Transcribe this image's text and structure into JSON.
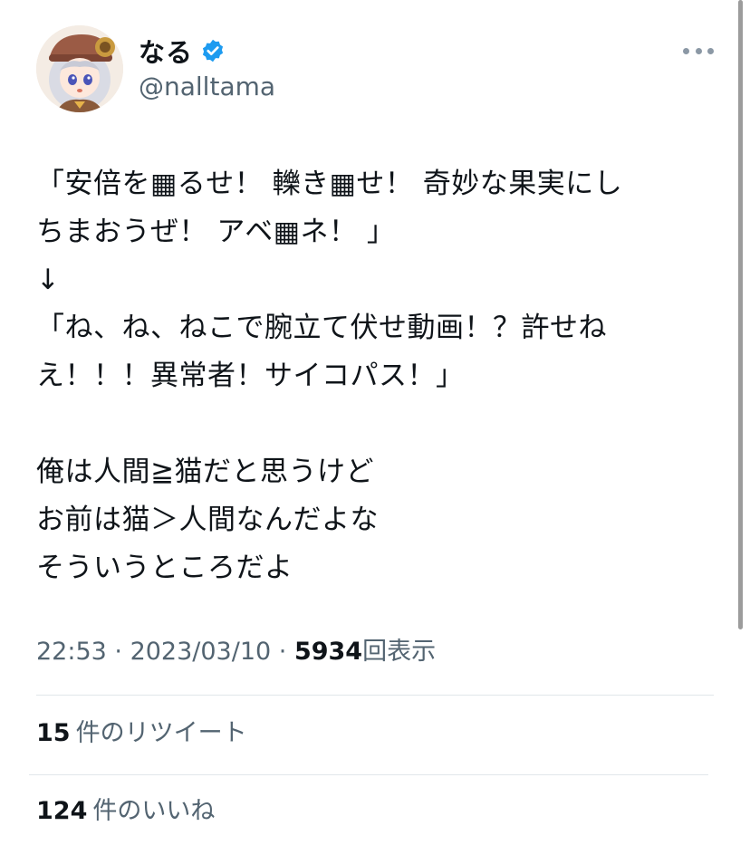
{
  "author": {
    "display_name": "なる",
    "handle": "@nalltama",
    "verified": true,
    "avatar": "anime-girl-avatar"
  },
  "tweet": {
    "text": "「安倍を▦るせ！ 轢き▦せ！ 奇妙な果実にし\nちまおうぜ！ アベ▦ネ！ 」\n↓\n「ね、ね、ねこで腕立て伏せ動画！？許せね\nえ！！！異常者！サイコパス！」\n\n俺は人間≧猫だと思うけど\nお前は猫＞人間なんだよな\nそういうところだよ"
  },
  "meta": {
    "time": "22:53",
    "sep1": " · ",
    "date": "2023/03/10",
    "sep2": " · ",
    "views_count": "5934",
    "views_label": "回表示"
  },
  "stats": {
    "retweets": {
      "count": "15",
      "label": "件のリツイート"
    },
    "likes": {
      "count": "124",
      "label": "件のいいね"
    }
  },
  "colors": {
    "text": "#0f1419",
    "secondary": "#536471",
    "verified": "#1d9bf0",
    "divider": "#e1e6ea"
  },
  "icons": {
    "verified": "verified-badge-icon",
    "more": "more-icon"
  }
}
